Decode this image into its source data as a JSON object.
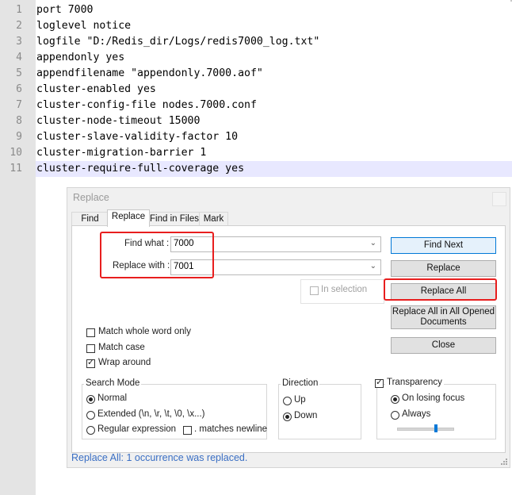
{
  "editor": {
    "lines": [
      {
        "num": "1",
        "text": "port 7000"
      },
      {
        "num": "2",
        "text": "loglevel notice"
      },
      {
        "num": "3",
        "text": "logfile \"D:/Redis_dir/Logs/redis7000_log.txt\""
      },
      {
        "num": "4",
        "text": "appendonly yes"
      },
      {
        "num": "5",
        "text": "appendfilename \"appendonly.7000.aof\""
      },
      {
        "num": "6",
        "text": "cluster-enabled yes"
      },
      {
        "num": "7",
        "text": "cluster-config-file nodes.7000.conf"
      },
      {
        "num": "8",
        "text": "cluster-node-timeout 15000"
      },
      {
        "num": "9",
        "text": "cluster-slave-validity-factor 10"
      },
      {
        "num": "10",
        "text": "cluster-migration-barrier 1"
      },
      {
        "num": "11",
        "text": "cluster-require-full-coverage yes"
      }
    ]
  },
  "dialog": {
    "title": "Replace",
    "tabs": {
      "find": "Find",
      "replace": "Replace",
      "find_in_files": "Find in Files",
      "mark": "Mark"
    },
    "find_what_label": "Find what :",
    "find_what_value": "7000",
    "replace_with_label": "Replace with :",
    "replace_with_value": "7001",
    "in_selection_label": "In selection",
    "buttons": {
      "find_next": "Find Next",
      "replace": "Replace",
      "replace_all": "Replace All",
      "replace_all_opened_line1": "Replace All in All Opened",
      "replace_all_opened_line2": "Documents",
      "close": "Close"
    },
    "options": {
      "match_whole_word": "Match whole word only",
      "match_case": "Match case",
      "wrap_around": "Wrap around"
    },
    "search_mode": {
      "title": "Search Mode",
      "normal": "Normal",
      "extended": "Extended (\\n, \\r, \\t, \\0, \\x...)",
      "regex": "Regular expression",
      "matches_newline": ". matches newline"
    },
    "direction": {
      "title": "Direction",
      "up": "Up",
      "down": "Down"
    },
    "transparency": {
      "title": "Transparency",
      "on_losing_focus": "On losing focus",
      "always": "Always"
    },
    "status": "Replace All: 1 occurrence was replaced."
  },
  "colors": {
    "highlight_box": "#e81e1e",
    "status_text": "#3a6fc4",
    "current_line": "#e8e8ff",
    "accent": "#0078d7"
  }
}
